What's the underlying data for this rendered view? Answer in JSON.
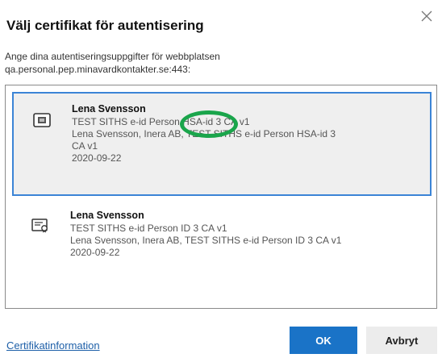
{
  "dialog": {
    "title": "Välj certifikat för autentisering",
    "description_line1": "Ange dina autentiseringsuppgifter för webbplatsen",
    "description_line2": "qa.personal.pep.minavardkontakter.se:443:"
  },
  "certificates": [
    {
      "name": "Lena Svensson",
      "lines": [
        "TEST SITHS e-id Person HSA-id 3 CA v1",
        "Lena Svensson, Inera AB, TEST SITHS e-id Person HSA-id 3",
        "CA v1",
        "2020-09-22"
      ],
      "selected": true,
      "icon": "smartcard-icon"
    },
    {
      "name": "Lena Svensson",
      "lines": [
        "TEST SITHS e-id Person ID 3 CA v1",
        "Lena Svensson, Inera AB, TEST SITHS e-id Person ID 3 CA v1",
        "2020-09-22"
      ],
      "selected": false,
      "icon": "certificate-icon"
    }
  ],
  "footer": {
    "info_link": "Certifikatinformation",
    "ok_label": "OK",
    "cancel_label": "Avbryt"
  },
  "colors": {
    "accent": "#1a73c7",
    "selected_border": "#3b84d6",
    "annotation_circle": "#1aa54b",
    "link": "#1d5fa8"
  }
}
